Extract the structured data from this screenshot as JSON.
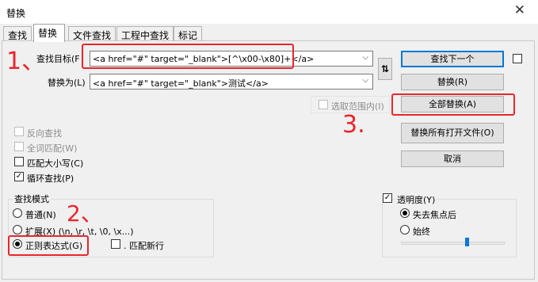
{
  "window": {
    "title": "替换"
  },
  "tabs": [
    {
      "label": "查找"
    },
    {
      "label": "替换"
    },
    {
      "label": "文件查找"
    },
    {
      "label": "工程中查找"
    },
    {
      "label": "标记"
    }
  ],
  "find": {
    "label": "查找目标(F",
    "value": "<a href=\"#\" target=\"_blank\">[^\\x00-\\x80]+</a>"
  },
  "replace": {
    "label": "替换为(L)",
    "value": "<a href=\"#\" target=\"_blank\">测试</a>"
  },
  "in_selection": {
    "label": "选取范围内(I)"
  },
  "buttons": {
    "find_next": "查找下一个",
    "replace": "替换(R)",
    "replace_all": "全部替换(A)",
    "replace_all_open": "替换所有打开文件(O)",
    "cancel": "取消"
  },
  "options": {
    "backward": "反向查找",
    "whole_word": "全词匹配(W)",
    "match_case": "匹配大小写(C)",
    "wrap": "循环查找(P)"
  },
  "search_mode": {
    "title": "查找模式",
    "normal": "普通(N)",
    "extended": "扩展(X) (\\n, \\r, \\t, \\0, \\x...)",
    "regex": "正则表达式(G)",
    "dot_newline": ". 匹配新行",
    "selected": "regex"
  },
  "transparency": {
    "title": "透明度(Y)",
    "on_lose_focus": "失去焦点后",
    "always": "始终",
    "selected": "on_lose_focus",
    "level_fraction": 0.63
  },
  "annotations": {
    "one": "1、",
    "two": "2、",
    "three": "3."
  },
  "colors": {
    "accent": "#0078d7",
    "annotation_red": "#e8262c"
  }
}
